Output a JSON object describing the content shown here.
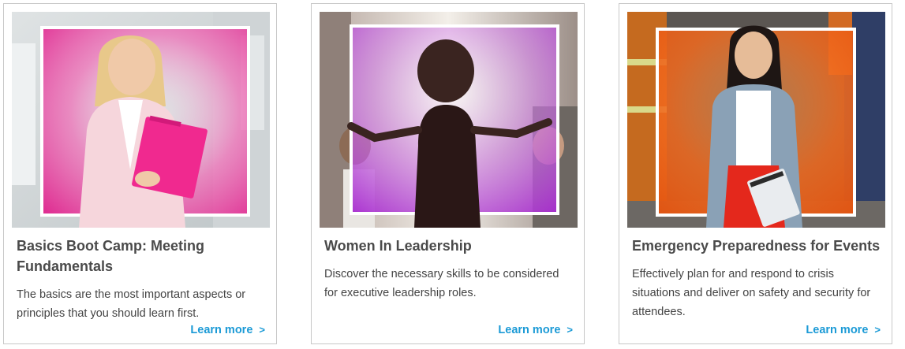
{
  "cards": [
    {
      "title": "Basics Boot Camp: Meeting Fundamentals",
      "description": "The basics are the most important aspects or principles that you should learn first.",
      "link_label": "Learn more",
      "link_chevron": ">",
      "accent": "#e6309a"
    },
    {
      "title": "Women In Leadership",
      "description": "Discover the necessary skills to be considered for executive leadership roles.",
      "link_label": "Learn more",
      "link_chevron": ">",
      "accent": "#b33ed6"
    },
    {
      "title": "Emergency Preparedness for Events",
      "description": "Effectively plan for and respond to crisis situations and deliver on safety and security for attendees.",
      "link_label": "Learn more",
      "link_chevron": ">",
      "accent": "#ee5a17"
    }
  ],
  "colors": {
    "link": "#1b9ad6",
    "title": "#4a4a4a",
    "border": "#c8c8c8"
  }
}
